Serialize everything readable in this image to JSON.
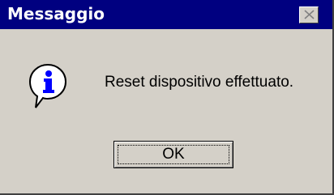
{
  "window": {
    "title": "Messaggio",
    "close_icon": "close-icon"
  },
  "content": {
    "icon": "info-icon",
    "message": "Reset dispositivo effettuato."
  },
  "buttons": {
    "ok_label": "OK"
  },
  "colors": {
    "titlebar": "#000080",
    "dialog_bg": "#d4d0c8",
    "title_text": "#ffffff",
    "icon_blue": "#0000ff"
  }
}
